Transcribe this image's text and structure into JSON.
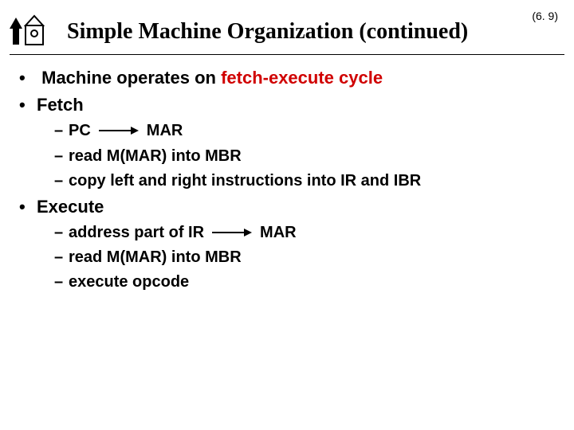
{
  "header": {
    "title": "Simple Machine Organization (continued)",
    "page_ref": "(6. 9)"
  },
  "bullets": {
    "b1": {
      "prefix": "Machine operates on ",
      "emph": "fetch-execute cycle"
    },
    "b2": "Fetch",
    "b2_1": {
      "lhs": "PC",
      "rhs": "MAR"
    },
    "b2_2": "read M(MAR) into MBR",
    "b2_3": "copy left and right instructions into IR and IBR",
    "b3": "Execute",
    "b3_1": {
      "lhs": "address part of IR",
      "rhs": "MAR"
    },
    "b3_2": "read M(MAR) into MBR",
    "b3_3": "execute opcode"
  }
}
